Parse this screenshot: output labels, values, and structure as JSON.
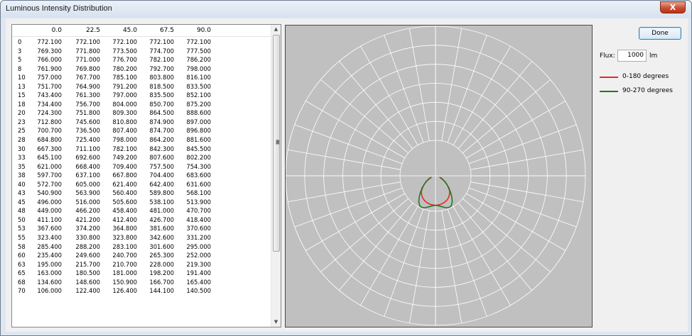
{
  "window": {
    "title": "Luminous Intensity Distribution",
    "close_label": "X"
  },
  "table": {
    "headers": [
      "0.0",
      "22.5",
      "45.0",
      "67.5",
      "90.0"
    ],
    "rows": [
      [
        "0",
        "772.100",
        "772.100",
        "772.100",
        "772.100",
        "772.100"
      ],
      [
        "3",
        "769.300",
        "771.800",
        "773.500",
        "774.700",
        "777.500"
      ],
      [
        "5",
        "766.000",
        "771.000",
        "776.700",
        "782.100",
        "786.200"
      ],
      [
        "8",
        "761.900",
        "769.800",
        "780.200",
        "792.700",
        "798.000"
      ],
      [
        "10",
        "757.000",
        "767.700",
        "785.100",
        "803.800",
        "816.100"
      ],
      [
        "13",
        "751.700",
        "764.900",
        "791.200",
        "818.500",
        "833.500"
      ],
      [
        "15",
        "743.400",
        "761.300",
        "797.000",
        "835.500",
        "852.100"
      ],
      [
        "18",
        "734.400",
        "756.700",
        "804.000",
        "850.700",
        "875.200"
      ],
      [
        "20",
        "724.300",
        "751.800",
        "809.300",
        "864.500",
        "888.600"
      ],
      [
        "23",
        "712.800",
        "745.600",
        "810.800",
        "874.900",
        "897.000"
      ],
      [
        "25",
        "700.700",
        "736.500",
        "807.400",
        "874.700",
        "896.800"
      ],
      [
        "28",
        "684.800",
        "725.400",
        "798.000",
        "864.200",
        "881.600"
      ],
      [
        "30",
        "667.300",
        "711.100",
        "782.100",
        "842.300",
        "845.500"
      ],
      [
        "33",
        "645.100",
        "692.600",
        "749.200",
        "807.600",
        "802.200"
      ],
      [
        "35",
        "621.000",
        "668.400",
        "709.400",
        "757.500",
        "754.300"
      ],
      [
        "38",
        "597.700",
        "637.100",
        "667.800",
        "704.400",
        "683.600"
      ],
      [
        "40",
        "572.700",
        "605.000",
        "621.400",
        "642.400",
        "631.600"
      ],
      [
        "43",
        "540.900",
        "563.900",
        "560.400",
        "589.800",
        "568.100"
      ],
      [
        "45",
        "496.000",
        "516.000",
        "505.600",
        "538.100",
        "513.900"
      ],
      [
        "48",
        "449.000",
        "466.200",
        "458.400",
        "481.000",
        "470.700"
      ],
      [
        "50",
        "411.100",
        "421.200",
        "412.400",
        "426.700",
        "418.400"
      ],
      [
        "53",
        "367.600",
        "374.200",
        "364.800",
        "381.600",
        "370.600"
      ],
      [
        "55",
        "323.400",
        "330.800",
        "323.800",
        "342.600",
        "331.200"
      ],
      [
        "58",
        "285.400",
        "288.200",
        "283.100",
        "301.600",
        "295.000"
      ],
      [
        "60",
        "235.400",
        "249.600",
        "240.700",
        "265.300",
        "252.000"
      ],
      [
        "63",
        "195.000",
        "215.700",
        "210.700",
        "228.000",
        "219.300"
      ],
      [
        "65",
        "163.000",
        "180.500",
        "181.000",
        "198.200",
        "191.400"
      ],
      [
        "68",
        "134.600",
        "148.600",
        "150.900",
        "166.700",
        "165.400"
      ],
      [
        "70",
        "106.000",
        "122.400",
        "126.400",
        "144.100",
        "140.500"
      ]
    ]
  },
  "scrollbar": {
    "up_icon": "▲",
    "down_icon": "▼"
  },
  "controls": {
    "done_label": "Done",
    "flux_label": "Flux:",
    "flux_value": "1000",
    "flux_unit": "lm"
  },
  "legend": [
    {
      "label": "0-180 degrees",
      "color": "#e8262a"
    },
    {
      "label": "90-270 degrees",
      "color": "#1c7c1c"
    }
  ],
  "chart_data": {
    "type": "polar",
    "angles_deg": [
      0,
      3,
      5,
      8,
      10,
      13,
      15,
      18,
      20,
      23,
      25,
      28,
      30,
      33,
      35,
      38,
      40,
      43,
      45,
      48,
      50,
      53,
      55,
      58,
      60,
      63,
      65,
      68,
      70
    ],
    "series": [
      {
        "name": "0-180 degrees",
        "color": "#e8262a",
        "column": "0.0",
        "values": [
          772.1,
          769.3,
          766.0,
          761.9,
          757.0,
          751.7,
          743.4,
          734.4,
          724.3,
          712.8,
          700.7,
          684.8,
          667.3,
          645.1,
          621.0,
          597.7,
          572.7,
          540.9,
          496.0,
          449.0,
          411.1,
          367.6,
          323.4,
          285.4,
          235.4,
          195.0,
          163.0,
          134.6,
          106.0
        ]
      },
      {
        "name": "90-270 degrees",
        "color": "#1c7c1c",
        "column": "90.0",
        "values": [
          772.1,
          777.5,
          786.2,
          798.0,
          816.1,
          833.5,
          852.1,
          875.2,
          888.6,
          897.0,
          896.8,
          881.6,
          845.5,
          802.2,
          754.3,
          683.6,
          631.6,
          568.1,
          513.9,
          470.7,
          418.4,
          370.6,
          331.2,
          295.0,
          252.0,
          219.3,
          191.4,
          165.4,
          140.5
        ]
      }
    ],
    "grid": true,
    "rmax": 900,
    "ring_count": 6,
    "spokes": 36,
    "background_color": "#c0c0c0",
    "grid_color": "#ffffff"
  }
}
